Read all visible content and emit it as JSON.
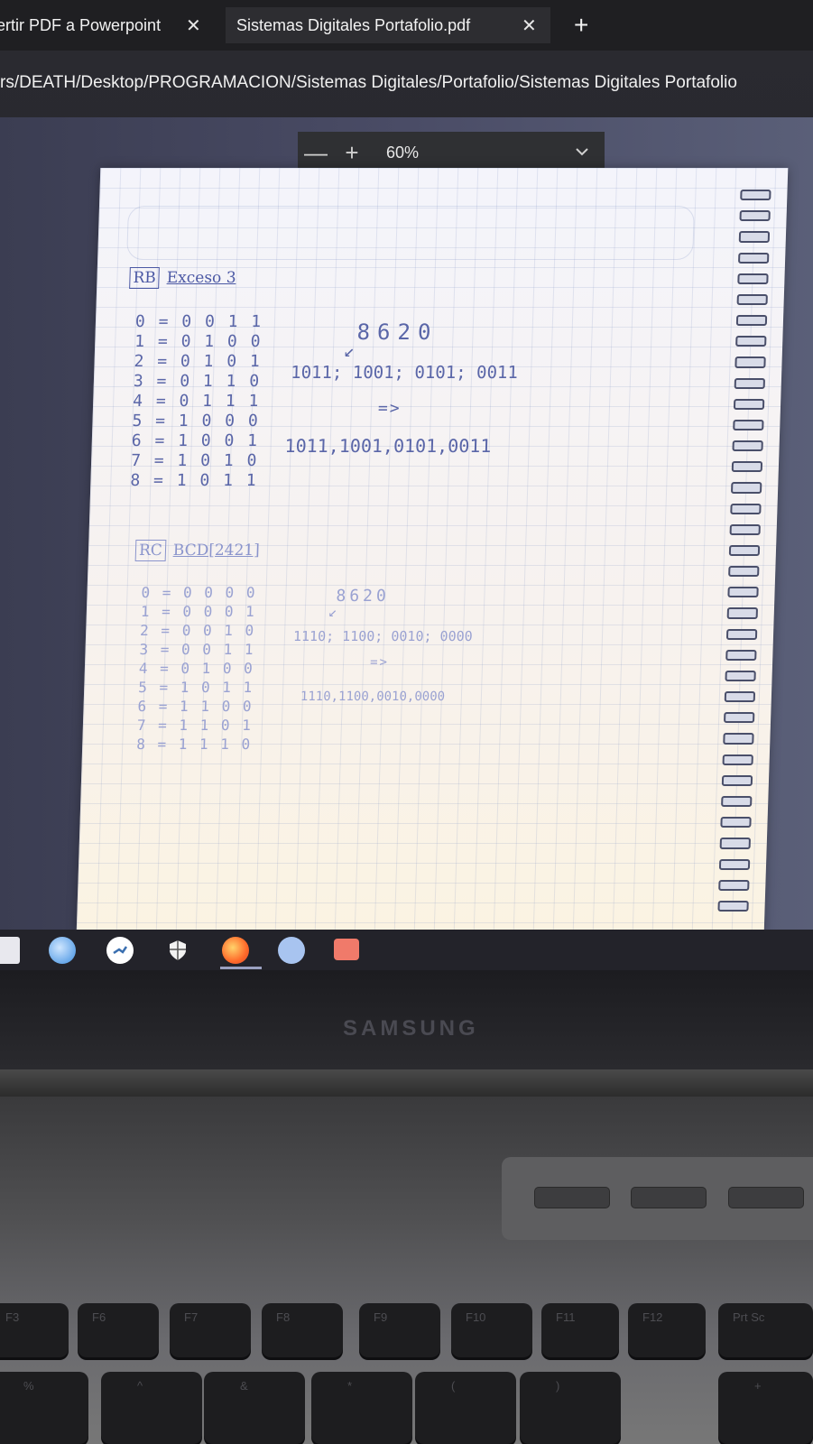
{
  "browser": {
    "tabs": [
      {
        "label": "ertir PDF a Powerpoint",
        "close": "✕"
      },
      {
        "label": "Sistemas Digitales Portafolio.pdf",
        "close": "✕"
      }
    ],
    "new_tab": "+",
    "address": "rs/DEATH/Desktop/PROGRAMACION/Sistemas Digitales/Portafolio/Sistemas Digitales Portafolio"
  },
  "pdf_toolbar": {
    "zoom_out": "—",
    "zoom_in": "+",
    "zoom_value": "60%",
    "zoom_dropdown_icon": "chevron-down-icon"
  },
  "notebook": {
    "section1": {
      "tag": "RB",
      "title": "Exceso 3",
      "table": "0 = 0 0 1 1\n1 = 0 1 0 0\n2 = 0 1 0 1\n3 = 0 1 1 0\n4 = 0 1 1 1\n5 = 1 0 0 0\n6 = 1 0 0 1\n7 = 1 0 1 0\n8 = 1 0 1 1",
      "number": "8620",
      "arrow": "↙",
      "groups": "1011; 1001; 0101; 0011",
      "implies": "=>",
      "result": "1011,1001,0101,0011"
    },
    "section2": {
      "tag": "RC",
      "title": "BCD[2421]",
      "table": "0 = 0 0 0 0\n1 = 0 0 0 1\n2 = 0 0 1 0\n3 = 0 0 1 1\n4 = 0 1 0 0\n5 = 1 0 1 1\n6 = 1 1 0 0\n7 = 1 1 0 1\n8 = 1 1 1 0",
      "number": "8620",
      "arrow": "↙",
      "groups": "1110; 1100; 0010; 0000",
      "implies": "=>",
      "result": "1110,1100,0010,0000"
    }
  },
  "taskbar": {
    "icons": [
      "windows-icon",
      "edge-icon",
      "steam-icon",
      "shield-icon",
      "firefox-icon",
      "chat-icon",
      "pdf-app-icon"
    ]
  },
  "laptop": {
    "brand": "SAMSUNG",
    "keys_row1": [
      "F3",
      "F6",
      "F7",
      "F8",
      "F9",
      "F10",
      "F11",
      "F12",
      "Prt Sc"
    ],
    "keys_row2": [
      "%",
      "^",
      "&",
      "*",
      "(",
      ")",
      "+"
    ]
  }
}
